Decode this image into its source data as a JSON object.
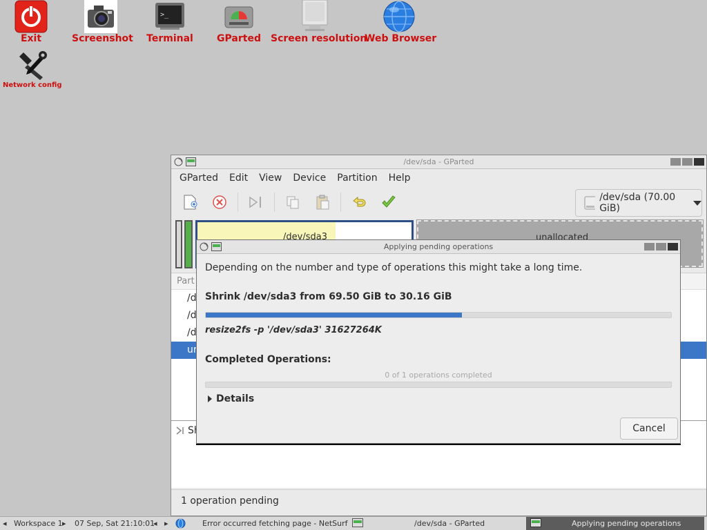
{
  "desktop": {
    "icons": [
      {
        "label": "Exit",
        "icon": "power-icon"
      },
      {
        "label": "Screenshot",
        "icon": "camera-icon"
      },
      {
        "label": "Terminal",
        "icon": "terminal-icon"
      },
      {
        "label": "GParted",
        "icon": "gparted-icon"
      },
      {
        "label": "Screen resolution",
        "icon": "monitor-icon"
      },
      {
        "label": "Web Browser",
        "icon": "globe-icon"
      },
      {
        "label": "Network config",
        "icon": "wrench-icon"
      }
    ]
  },
  "gparted": {
    "title": "/dev/sda - GParted",
    "menu": [
      "GParted",
      "Edit",
      "View",
      "Device",
      "Partition",
      "Help"
    ],
    "device_selector": "/dev/sda (70.00 GiB)",
    "partition_map": {
      "sda3_label": "/dev/sda3",
      "unallocated_label": "unallocated"
    },
    "list": {
      "header": "Part",
      "rows": [
        "/d",
        "/d",
        "/d",
        "ur"
      ]
    },
    "pending_list_item": "Sh",
    "status": "1 operation pending"
  },
  "dialog": {
    "title": "Applying pending operations",
    "description": "Depending on the number and type of operations this might take a long time.",
    "operation": "Shrink /dev/sda3 from 69.50 GiB to 30.16 GiB",
    "progress": 0.55,
    "command": "resize2fs -p '/dev/sda3' 31627264K",
    "completed_label": "Completed Operations:",
    "completed_count": "0 of 1 operations completed",
    "completed_progress": 0,
    "details_label": "Details",
    "cancel_label": "Cancel"
  },
  "taskbar": {
    "workspace": "Workspace 1",
    "datetime": "07 Sep, Sat 21:10:01",
    "tasks": [
      "Error occurred fetching page - NetSurf",
      "/dev/sda - GParted",
      "Applying pending operations"
    ]
  },
  "colors": {
    "desktop_label": "#cc1010",
    "progress_fill": "#3c76c6",
    "selection": "#3c76c6",
    "sda3_fill": "#f8f6b8"
  }
}
